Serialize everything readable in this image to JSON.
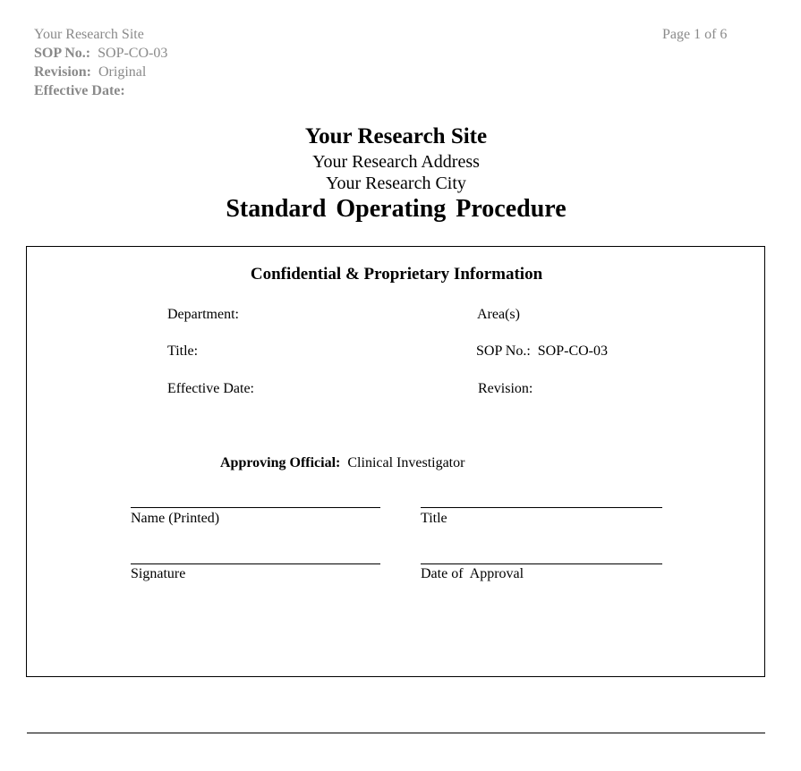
{
  "header": {
    "site": "Your Research Site",
    "sop_label": "SOP No.:",
    "sop_value": "SOP-CO-03",
    "revision_label": "Revision:",
    "revision_value": "Original",
    "effective_label": "Effective Date:",
    "page": "Page 1 of 6"
  },
  "title_block": {
    "site_name": "Your Research Site",
    "address": "Your Research Address",
    "city": "Your Research City",
    "doc_title": "Standard Operating Procedure"
  },
  "box": {
    "heading": "Confidential & Proprietary Information",
    "fields": {
      "department": "Department:",
      "areas": "Area(s)",
      "title": "Title:",
      "sop_no": "SOP No.:  SOP-CO-03",
      "effective_date": "Effective Date:",
      "revision": "Revision:"
    },
    "approving_label": "Approving Official:",
    "approving_value": "Clinical Investigator",
    "signature_fields": {
      "name_printed": "Name (Printed)",
      "title": "Title",
      "signature": "Signature",
      "date_of_approval": "Date of  Approval"
    }
  }
}
